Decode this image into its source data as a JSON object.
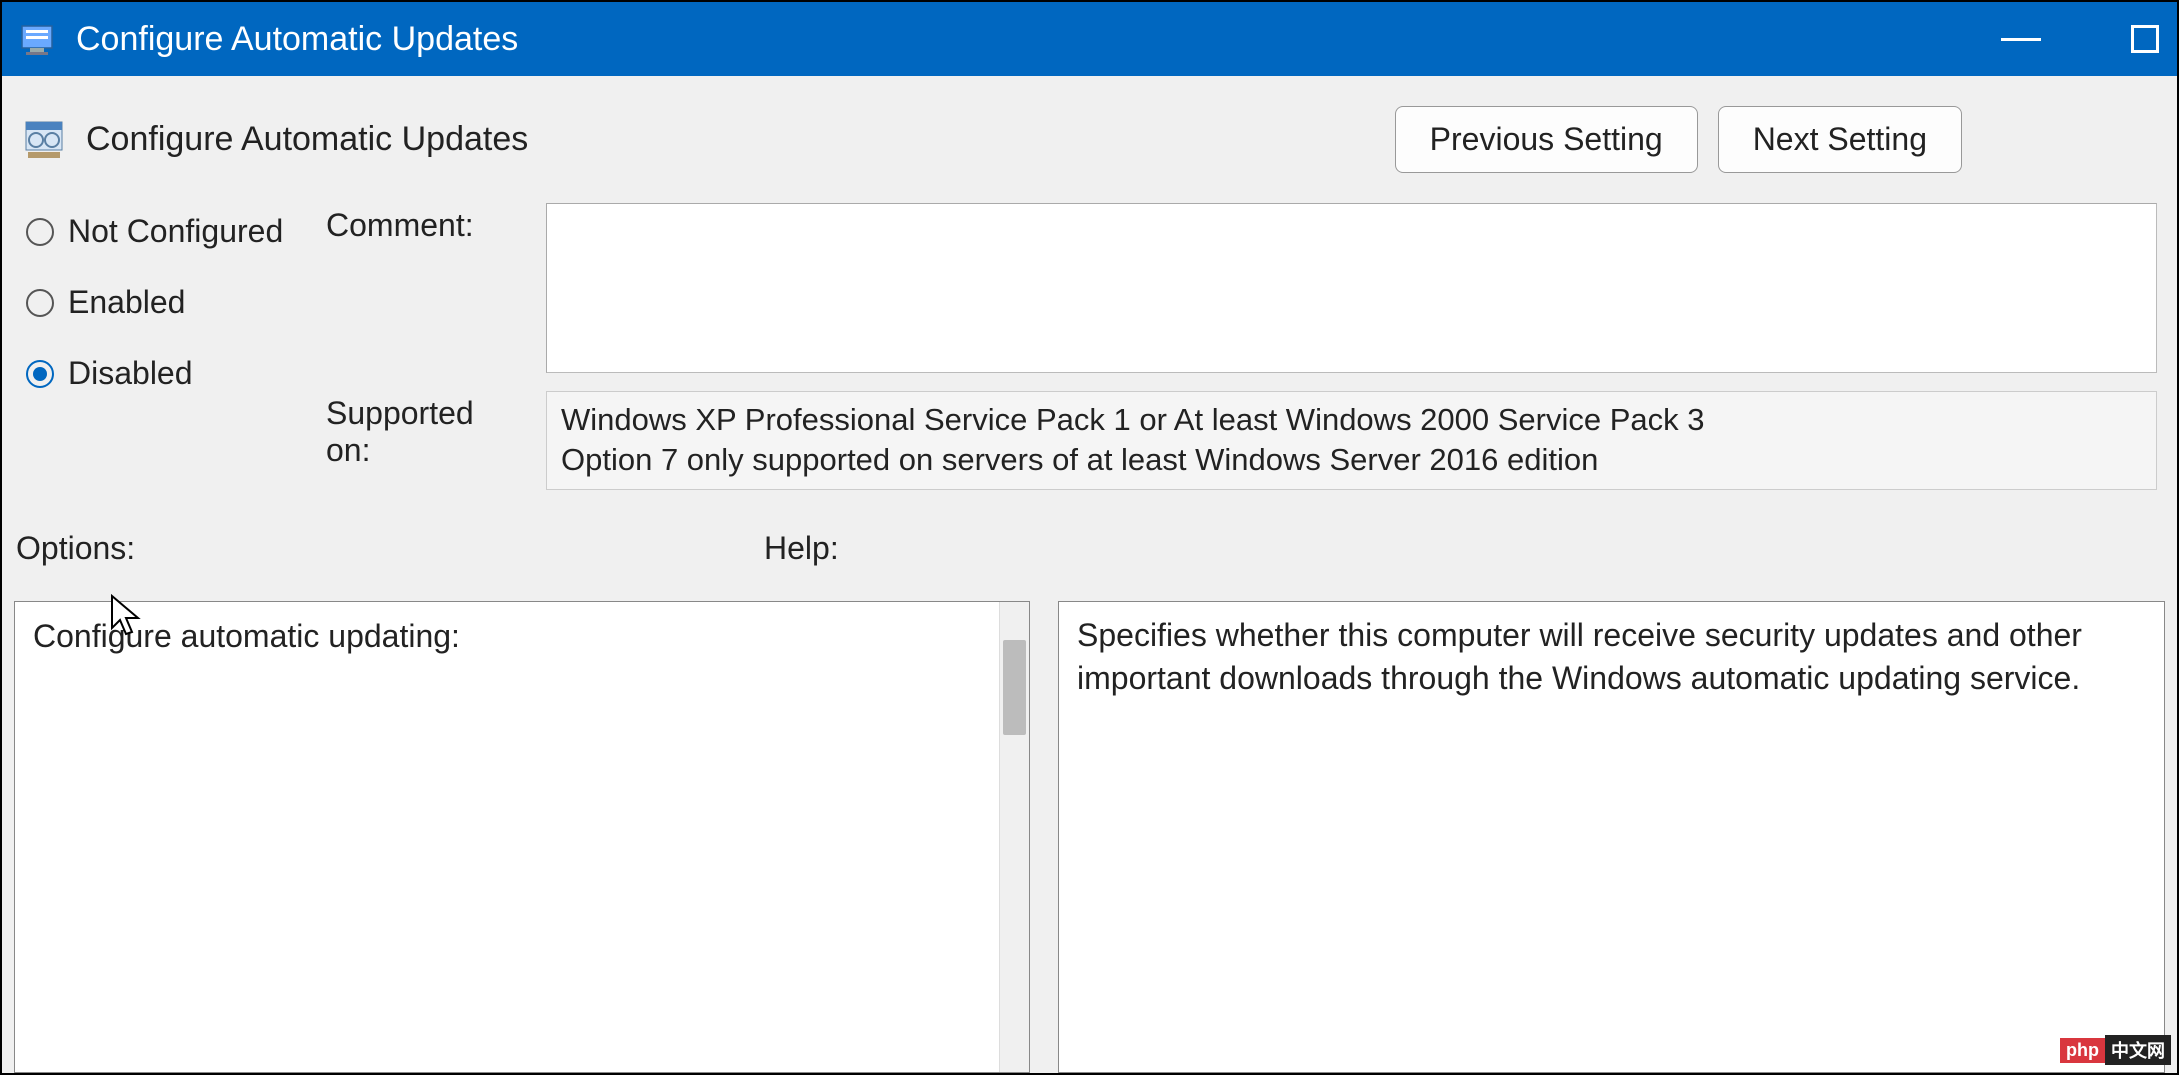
{
  "titlebar": {
    "title": "Configure Automatic Updates"
  },
  "header": {
    "policy_title": "Configure Automatic Updates",
    "previous_button": "Previous Setting",
    "next_button": "Next Setting"
  },
  "state_radios": {
    "not_configured": "Not Configured",
    "enabled": "Enabled",
    "disabled": "Disabled",
    "selected": "disabled"
  },
  "fields": {
    "comment_label": "Comment:",
    "comment_value": "",
    "supported_label": "Supported on:",
    "supported_value": "Windows XP Professional Service Pack 1 or At least Windows 2000 Service Pack 3\nOption 7 only supported on servers of at least Windows Server 2016 edition"
  },
  "sections": {
    "options_label": "Options:",
    "help_label": "Help:"
  },
  "options": {
    "heading": "Configure automatic updating:"
  },
  "help": {
    "text": "Specifies whether this computer will receive security updates and other important downloads through the Windows automatic updating service."
  },
  "watermark": {
    "a": "php",
    "b": "中文网"
  }
}
